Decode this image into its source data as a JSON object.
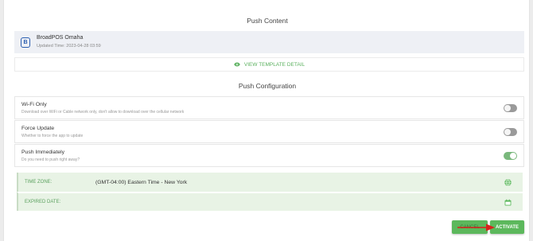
{
  "push_content": {
    "title": "Push Content",
    "app_name": "BroadPOS Omaha",
    "updated_time": "Updated Time: 2023-04-28 03:59",
    "app_icon_glyph": "B",
    "template_link": "VIEW TEMPLATE DETAIL"
  },
  "push_configuration": {
    "title": "Push Configuration",
    "rows": [
      {
        "title": "Wi-Fi Only",
        "desc": "Download over WiFi or Cable network only, don't allow to download over the cellular network",
        "enabled": false
      },
      {
        "title": "Force Update",
        "desc": "Whether to force the app to update",
        "enabled": false
      },
      {
        "title": "Push Immediately",
        "desc": "Do you need to push right away?",
        "enabled": true
      }
    ]
  },
  "time_zone": {
    "label": "TIME ZONE:",
    "value": "(GMT-04:00) Eastern Time - New York",
    "icon": "globe-icon"
  },
  "expired_date": {
    "label": "EXPIRED DATE:",
    "value": "",
    "icon": "calendar-icon"
  },
  "buttons": {
    "cancel": "CANCEL",
    "activate": "ACTIVATE"
  },
  "colors": {
    "accent": "#5cb85c",
    "row_bg": "#e8f3e5",
    "app_card_bg": "#eef0f5",
    "annotation_arrow": "#d9211c"
  }
}
